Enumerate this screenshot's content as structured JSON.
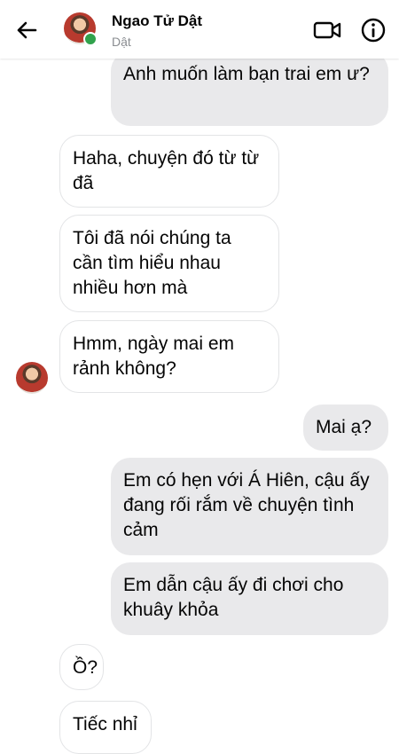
{
  "header": {
    "contact_name": "Ngao Tử Dật",
    "contact_sub": "Dật",
    "back_icon": "arrow-left-icon",
    "video_icon": "video-camera-icon",
    "info_icon": "info-icon"
  },
  "messages": [
    {
      "side": "out",
      "text": "Anh muốn làm bạn trai em ư?"
    },
    {
      "side": "in",
      "text": "Haha, chuyện đó từ từ đã"
    },
    {
      "side": "in",
      "text": "Tôi đã nói chúng ta cần tìm hiểu nhau nhiều hơn mà"
    },
    {
      "side": "in",
      "text": "Hmm, ngày mai em rảnh không?"
    },
    {
      "side": "out",
      "text": "Mai ạ?"
    },
    {
      "side": "out",
      "text": "Em có hẹn với Á Hiên, cậu ấy đang rối rắm về chuyện tình cảm"
    },
    {
      "side": "out",
      "text": "Em dẫn cậu ấy đi chơi cho khuây khỏa"
    },
    {
      "side": "in",
      "text": "Ồ?"
    },
    {
      "side": "in",
      "text": "Tiếc nhỉ"
    }
  ],
  "colors": {
    "outgoing_bubble": "#e9e9eb",
    "incoming_border": "#e3e4e6",
    "online": "#31a24c"
  }
}
